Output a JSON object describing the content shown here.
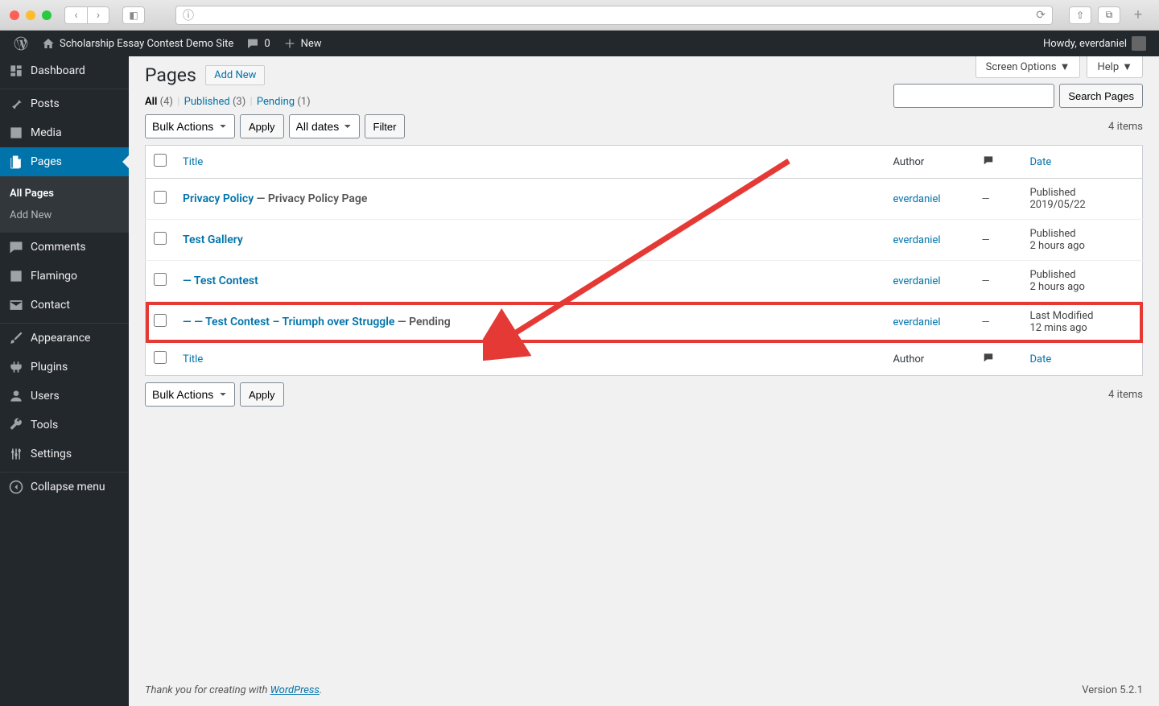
{
  "browser": {
    "url": ""
  },
  "adminbar": {
    "siteName": "Scholarship Essay Contest Demo Site",
    "commentsCount": "0",
    "newLabel": "New",
    "greeting": "Howdy, everdaniel"
  },
  "adminmenu": {
    "dashboard": "Dashboard",
    "posts": "Posts",
    "media": "Media",
    "pages": "Pages",
    "pagesSubAll": "All Pages",
    "pagesSubAddNew": "Add New",
    "comments": "Comments",
    "flamingo": "Flamingo",
    "contact": "Contact",
    "appearance": "Appearance",
    "plugins": "Plugins",
    "users": "Users",
    "tools": "Tools",
    "settings": "Settings",
    "collapse": "Collapse menu"
  },
  "screenMeta": {
    "optionsLabel": "Screen Options",
    "helpLabel": "Help"
  },
  "heading": {
    "title": "Pages",
    "addNew": "Add New"
  },
  "views": {
    "allLabel": "All",
    "allCount": "(4)",
    "publishedLabel": "Published",
    "publishedCount": "(3)",
    "pendingLabel": "Pending",
    "pendingCount": "(1)"
  },
  "filters": {
    "bulkLabel": "Bulk Actions",
    "applyLabel": "Apply",
    "dateLabel": "All dates",
    "filterLabel": "Filter",
    "searchBtn": "Search Pages",
    "countText": "4 items"
  },
  "columns": {
    "title": "Title",
    "author": "Author",
    "date": "Date"
  },
  "rows": [
    {
      "prefix": "",
      "title": "Privacy Policy",
      "state": " — Privacy Policy Page",
      "author": "everdaniel",
      "comments": "—",
      "dateStatus": "Published",
      "dateDetail": "2019/05/22",
      "highlight": false
    },
    {
      "prefix": "",
      "title": "Test Gallery",
      "state": "",
      "author": "everdaniel",
      "comments": "—",
      "dateStatus": "Published",
      "dateDetail": "2 hours ago",
      "highlight": false
    },
    {
      "prefix": "— ",
      "title": "Test Contest",
      "state": "",
      "author": "everdaniel",
      "comments": "—",
      "dateStatus": "Published",
      "dateDetail": "2 hours ago",
      "highlight": false
    },
    {
      "prefix": "— — ",
      "title": "Test Contest – Triumph over Struggle",
      "state": " — Pending",
      "author": "everdaniel",
      "comments": "—",
      "dateStatus": "Last Modified",
      "dateDetail": "12 mins ago",
      "highlight": true
    }
  ],
  "footer": {
    "thanks": "Thank you for creating with ",
    "wpLink": "WordPress",
    "period": ".",
    "version": "Version 5.2.1"
  }
}
